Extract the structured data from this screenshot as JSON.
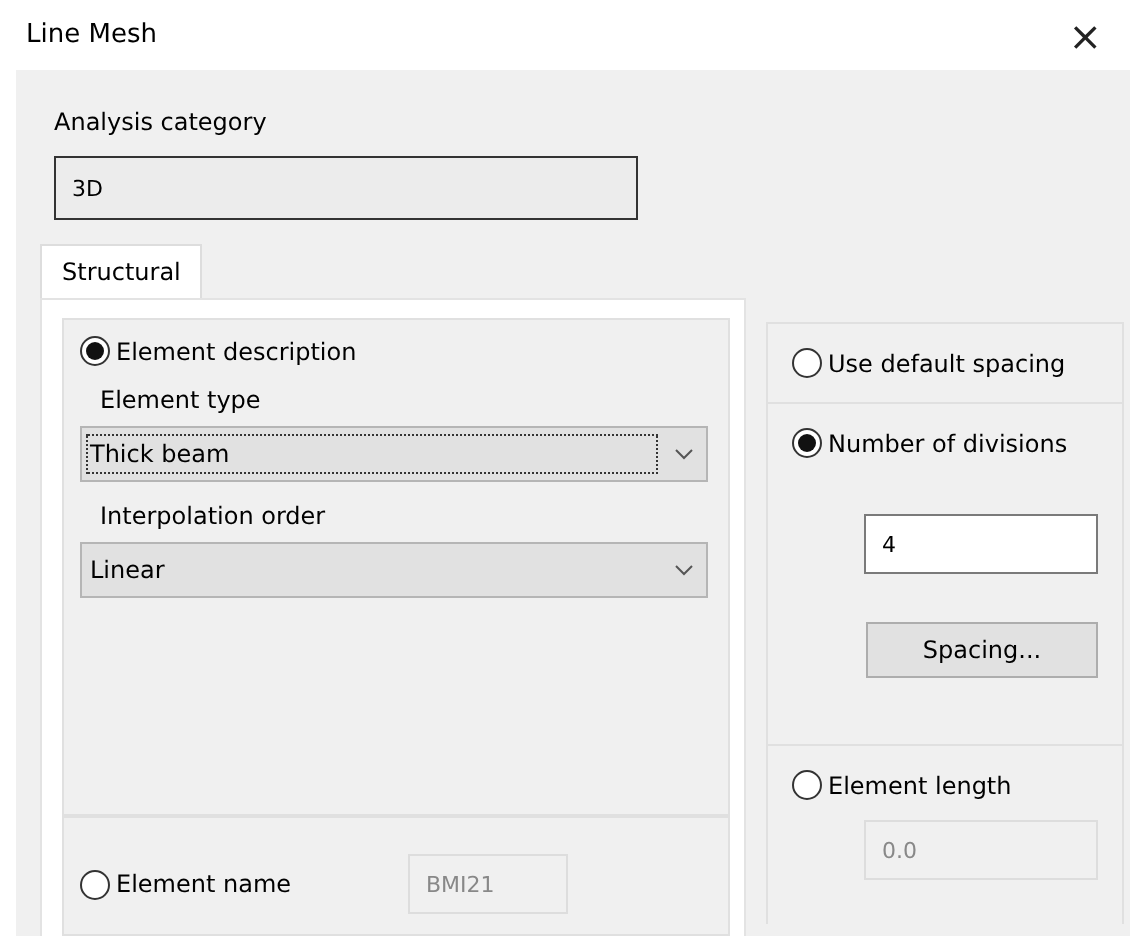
{
  "window": {
    "title": "Line Mesh",
    "close": "×"
  },
  "analysis_category": {
    "label": "Analysis category",
    "value": "3D"
  },
  "tabs": [
    {
      "label": "Structural",
      "selected": true
    }
  ],
  "element_description": {
    "label": "Element description",
    "selected": true,
    "element_type": {
      "label": "Element type",
      "value": "Thick beam",
      "focused": true
    },
    "interpolation_order": {
      "label": "Interpolation order",
      "value": "Linear",
      "focused": false
    }
  },
  "element_name": {
    "label": "Element name",
    "selected": false,
    "value": "BMI21",
    "disabled": true
  },
  "spacing": [
    {
      "label": "Use default spacing",
      "selected": false
    },
    {
      "label": "Number of divisions",
      "selected": true,
      "value": "4",
      "button": "Spacing..."
    },
    {
      "label": "Element length",
      "selected": false,
      "value": "0.0",
      "disabled": true
    }
  ]
}
